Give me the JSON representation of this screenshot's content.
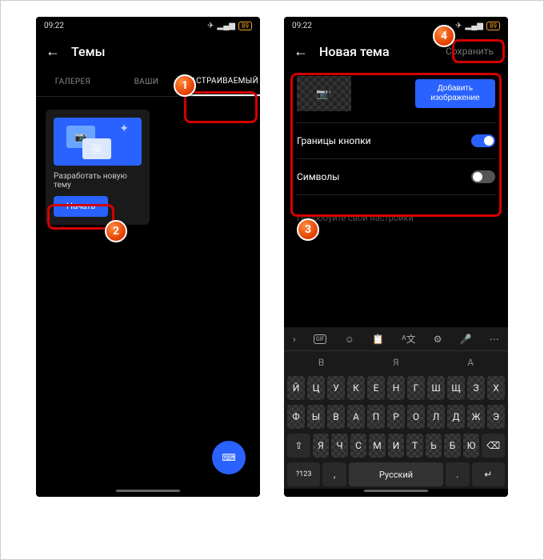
{
  "status": {
    "time": "09:22",
    "battery": "89"
  },
  "left": {
    "title": "Темы",
    "tabs": {
      "gallery": "ГАЛЕРЕЯ",
      "yours": "ВАШИ",
      "custom": "НАСТРАИВАЕМЫЙ"
    },
    "card_label": "Разработать новую тему",
    "start": "Начать"
  },
  "right": {
    "title": "Новая тема",
    "save": "Сохранить",
    "add_image": "Добавить изображение",
    "opt_borders": "Границы кнопки",
    "opt_symbols": "Символы",
    "try_settings": "Попробуйте свои настройки",
    "suggestions": [
      "В",
      "Я",
      "А"
    ],
    "rows": {
      "r1": [
        "Й",
        "Ц",
        "У",
        "К",
        "Е",
        "Н",
        "Г",
        "Ш",
        "Щ",
        "З",
        "Х"
      ],
      "r2": [
        "Ф",
        "Ы",
        "В",
        "А",
        "П",
        "Р",
        "О",
        "Л",
        "Д",
        "Ж",
        "Э"
      ],
      "r3": [
        "Я",
        "Ч",
        "С",
        "М",
        "И",
        "Т",
        "Ь",
        "Б",
        "Ю"
      ]
    },
    "space": "Русский",
    "shift": "⇧",
    "backspace": "⌫",
    "sym": "?123",
    "comma": ",",
    "period": ".",
    "enter": "↵"
  },
  "callouts": {
    "c1": "1",
    "c2": "2",
    "c3": "3",
    "c4": "4"
  }
}
